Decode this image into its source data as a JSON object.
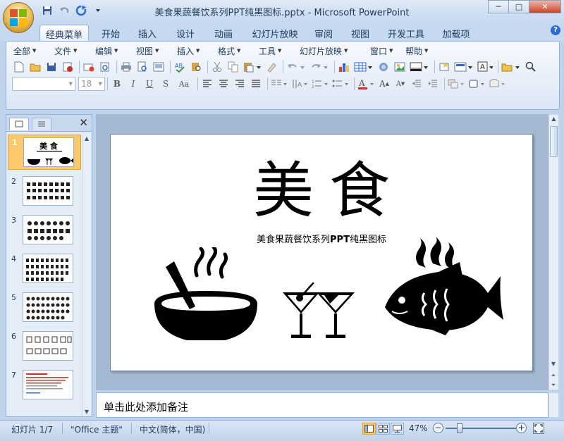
{
  "window": {
    "title": "美食果蔬餐饮系列PPT纯黑图标.pptx - Microsoft PowerPoint",
    "controls": {
      "minimize": "─",
      "maximize": "□",
      "close": "✕"
    }
  },
  "ribbon_tabs": [
    {
      "label": "经典菜单",
      "active": true
    },
    {
      "label": "开始"
    },
    {
      "label": "插入"
    },
    {
      "label": "设计"
    },
    {
      "label": "动画"
    },
    {
      "label": "幻灯片放映"
    },
    {
      "label": "审阅"
    },
    {
      "label": "视图"
    },
    {
      "label": "开发工具"
    },
    {
      "label": "加载项"
    }
  ],
  "help_symbol": "?",
  "classic_menu": [
    "全部",
    "文件",
    "编辑",
    "视图",
    "插入",
    "格式",
    "工具",
    "幻灯片放映",
    "窗口",
    "帮助"
  ],
  "format_bar": {
    "font_size": "18",
    "bold": "B",
    "italic": "I",
    "underline": "U",
    "strike": "S",
    "change_case": "Aa",
    "font_color": "A",
    "grow_font": "A",
    "shrink_font": "A",
    "text_box": "A"
  },
  "thumbnails": [
    {
      "num": "1",
      "title": "美 食",
      "active": true
    },
    {
      "num": "2"
    },
    {
      "num": "3"
    },
    {
      "num": "4"
    },
    {
      "num": "5"
    },
    {
      "num": "6"
    },
    {
      "num": "7"
    }
  ],
  "slide": {
    "title": "美食",
    "subtitle_prefix": "美食果蔬餐饮系列",
    "subtitle_bold": "PPT",
    "subtitle_suffix": "纯黑图标"
  },
  "notes_placeholder": "单击此处添加备注",
  "status": {
    "slide_info": "幻灯片 1/7",
    "theme": "\"Office 主题\"",
    "language": "中文(简体，中国)",
    "zoom": "47%",
    "zoom_minus": "−",
    "zoom_plus": "+"
  }
}
